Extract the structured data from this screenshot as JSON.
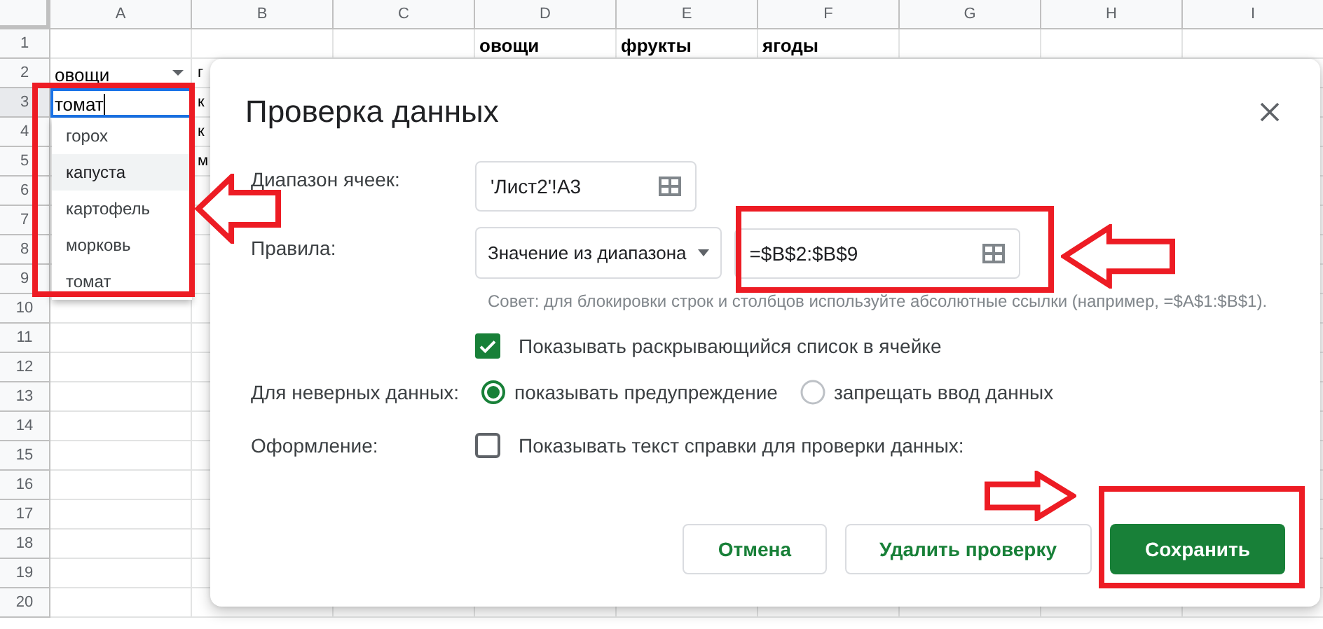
{
  "sheet": {
    "columns": [
      "A",
      "B",
      "C",
      "D",
      "E",
      "F",
      "G",
      "H",
      "I"
    ],
    "rows": [
      {
        "header": "1",
        "cells": [
          null,
          null,
          null,
          {
            "text": "овощи",
            "bold": true
          },
          {
            "text": "фрукты",
            "bold": true
          },
          {
            "text": "ягоды",
            "bold": true
          }
        ]
      },
      {
        "header": "2",
        "cells": [
          {
            "text": "овощи",
            "kind": "dropdown"
          },
          {
            "text": "г"
          }
        ]
      },
      {
        "header": "3",
        "selected": true,
        "cells": [
          {
            "text": "томат",
            "kind": "editing"
          },
          {
            "text": "к"
          }
        ]
      },
      {
        "header": "4",
        "cells": [
          null,
          {
            "text": "к"
          }
        ]
      },
      {
        "header": "5",
        "cells": [
          null,
          {
            "text": "м"
          }
        ]
      },
      {
        "header": "6",
        "cells": []
      },
      {
        "header": "7",
        "cells": []
      },
      {
        "header": "8",
        "cells": []
      },
      {
        "header": "9",
        "cells": []
      },
      {
        "header": "10",
        "cells": []
      },
      {
        "header": "11",
        "cells": []
      },
      {
        "header": "12",
        "cells": []
      },
      {
        "header": "13",
        "cells": []
      },
      {
        "header": "14",
        "cells": []
      },
      {
        "header": "15",
        "cells": []
      },
      {
        "header": "16",
        "cells": []
      },
      {
        "header": "17",
        "cells": []
      },
      {
        "header": "18",
        "cells": []
      },
      {
        "header": "19",
        "cells": []
      },
      {
        "header": "20",
        "cells": []
      }
    ]
  },
  "cell_dropdown": {
    "items": [
      {
        "label": "горох",
        "selected": false
      },
      {
        "label": "капуста",
        "selected": true
      },
      {
        "label": "картофель",
        "selected": false
      },
      {
        "label": "морковь",
        "selected": false
      },
      {
        "label": "томат",
        "selected": false
      }
    ]
  },
  "dialog": {
    "title": "Проверка данных",
    "range_label": "Диапазон ячеек:",
    "range_value": "'Лист2'!A3",
    "rules_label": "Правила:",
    "rule_type": "Значение из диапазона",
    "rule_range": "=$B$2:$B$9",
    "hint": "Совет: для блокировки строк и столбцов используйте абсолютные ссылки (например, =$A$1:$B$1).",
    "show_dropdown": {
      "label": "Показывать раскрывающийся список в ячейке",
      "checked": true
    },
    "invalid_label": "Для неверных данных:",
    "invalid_options": [
      {
        "label": "показывать предупреждение",
        "selected": true
      },
      {
        "label": "запрещать ввод данных",
        "selected": false
      }
    ],
    "appearance_label": "Оформление:",
    "help_text": {
      "label": "Показывать текст справки для проверки данных:",
      "checked": false
    },
    "buttons": [
      {
        "label": "Отмена",
        "kind": "secondary"
      },
      {
        "label": "Удалить проверку",
        "kind": "secondary"
      },
      {
        "label": "Сохранить",
        "kind": "primary"
      }
    ]
  },
  "annotations": [
    {
      "kind": "frame"
    },
    {
      "kind": "arrow-left"
    },
    {
      "kind": "frame"
    },
    {
      "kind": "arrow-left"
    },
    {
      "kind": "arrow-right"
    },
    {
      "kind": "frame"
    }
  ]
}
